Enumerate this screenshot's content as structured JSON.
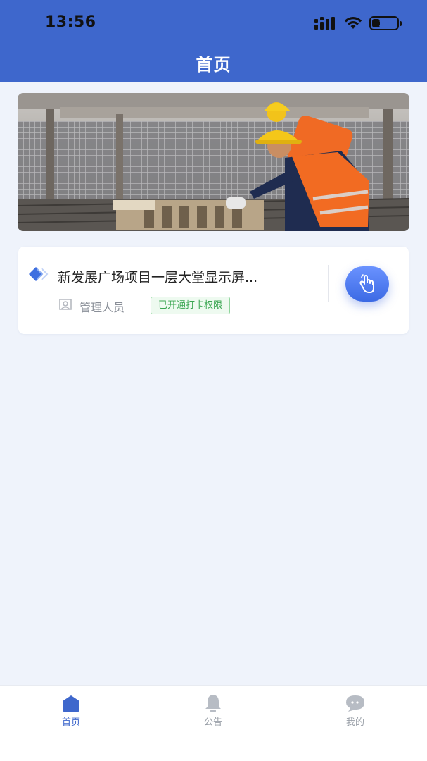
{
  "status_bar": {
    "time": "13:56",
    "battery_level": "33",
    "battery_fraction": 0.33,
    "signal_icon": "cellular-signal-icon",
    "wifi_icon": "wifi-icon",
    "battery_icon": "battery-icon"
  },
  "header": {
    "title": "首页",
    "background_color": "#3e67cc"
  },
  "banner": {
    "image": "construction-workers-banner"
  },
  "project_card": {
    "title": "新发展广场项目一层大堂显示屏...",
    "role": "管理人员",
    "permission_badge": "已开通打卡权限",
    "project_icon": "diamond-icon",
    "role_icon": "user-icon",
    "action_icon": "hand-pointer-icon",
    "badge_color": "#3aa651"
  },
  "tabbar": {
    "tabs": [
      {
        "label": "首页",
        "icon": "home-icon",
        "active": true
      },
      {
        "label": "公告",
        "icon": "bell-icon",
        "active": false
      },
      {
        "label": "我的",
        "icon": "chat-bubble-icon",
        "active": false
      }
    ],
    "active_color": "#3e67cc",
    "inactive_color": "#9aa0a8"
  }
}
